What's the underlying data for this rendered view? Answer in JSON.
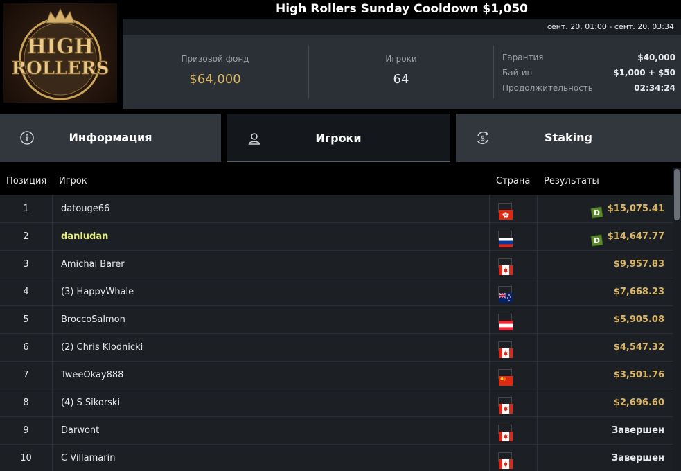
{
  "logo": {
    "line1": "HIGH",
    "line2": "ROLLERS"
  },
  "header": {
    "title": "High Rollers Sunday Cooldown $1,050",
    "dates": "сент. 20, 01:00 - сент. 20, 03:34"
  },
  "stats": {
    "prize_label": "Призовой фонд",
    "prize_value": "$64,000",
    "players_label": "Игроки",
    "players_value": "64",
    "details": [
      {
        "label": "Гарантия",
        "value": "$40,000"
      },
      {
        "label": "Бай-ин",
        "value": "$1,000 + $50"
      },
      {
        "label": "Продолжительность",
        "value": "02:34:24"
      }
    ]
  },
  "tabs": [
    {
      "label": "Информация",
      "icon": "info-icon"
    },
    {
      "label": "Игроки",
      "icon": "user-icon"
    },
    {
      "label": "Staking",
      "icon": "dollar-exchange-icon"
    }
  ],
  "table": {
    "headers": {
      "pos": "Позиция",
      "player": "Игрок",
      "country": "Страна",
      "results": "Результаты"
    },
    "rows": [
      {
        "pos": "1",
        "player": "datouge66",
        "country": "HK",
        "result": "$15,075.41",
        "staking": true,
        "highlight": false,
        "done": false
      },
      {
        "pos": "2",
        "player": "danludan",
        "country": "RU",
        "result": "$14,647.77",
        "staking": true,
        "highlight": true,
        "done": false
      },
      {
        "pos": "3",
        "player": "Amichai Barer",
        "country": "CA",
        "result": "$9,957.83",
        "staking": false,
        "highlight": false,
        "done": false
      },
      {
        "pos": "4",
        "player": "(3) HappyWhale",
        "country": "NZ",
        "result": "$7,668.23",
        "staking": false,
        "highlight": false,
        "done": false
      },
      {
        "pos": "5",
        "player": "BroccoSalmon",
        "country": "AT",
        "result": "$5,905.08",
        "staking": false,
        "highlight": false,
        "done": false
      },
      {
        "pos": "6",
        "player": "(2) Chris Klodnicki",
        "country": "CA",
        "result": "$4,547.32",
        "staking": false,
        "highlight": false,
        "done": false
      },
      {
        "pos": "7",
        "player": "TweeOkay888",
        "country": "CN",
        "result": "$3,501.76",
        "staking": false,
        "highlight": false,
        "done": false
      },
      {
        "pos": "8",
        "player": "(4) S Sikorski",
        "country": "CA",
        "result": "$2,696.60",
        "staking": false,
        "highlight": false,
        "done": false
      },
      {
        "pos": "9",
        "player": "Darwont",
        "country": "CA",
        "result": "Завершен",
        "staking": false,
        "highlight": false,
        "done": true
      },
      {
        "pos": "10",
        "player": "C Villamarin",
        "country": "CA",
        "result": "Завершен",
        "staking": false,
        "highlight": false,
        "done": true
      }
    ]
  },
  "colors": {
    "gold": "#d9b463",
    "highlight_name": "#e4ec7a",
    "staking_green": "#5a8a2a"
  }
}
